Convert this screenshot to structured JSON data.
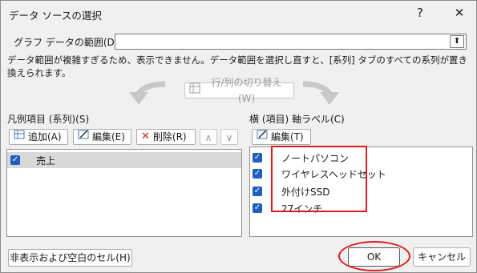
{
  "dialog": {
    "title": "データ ソースの選択",
    "help": "?",
    "close": "✕"
  },
  "range": {
    "label": "グラフ データの範囲(D):",
    "value": "",
    "collapse": "⬆"
  },
  "message": "データ範囲が複雑すぎるため、表示できません。データ範囲を選択し直すと、[系列] タブのすべての系列が置き換えられます。",
  "switch_button": "行/列の切り替え(W)",
  "legend": {
    "label": "凡例項目 (系列)(S)",
    "add": "追加(A)",
    "edit": "編集(E)",
    "delete": "削除(R)",
    "up": "∧",
    "down": "∨",
    "items": [
      {
        "label": "売上",
        "checked": true
      }
    ]
  },
  "axis": {
    "label": "横 (項目) 軸ラベル(C)",
    "edit": "編集(T)",
    "items": [
      {
        "label": "ノートパソコン",
        "checked": true
      },
      {
        "label": "ワイヤレスヘッドセット",
        "checked": true
      },
      {
        "label": "外付けSSD",
        "checked": true
      },
      {
        "label": "27インチ",
        "checked": true
      }
    ]
  },
  "footer": {
    "hidden_cells": "非表示および空白のセル(H)",
    "ok": "OK",
    "cancel": "キャンセル"
  },
  "colors": {
    "accent": "#1f5fbf",
    "highlight": "#e01b1b",
    "selected_row": "#d9d9d9"
  }
}
